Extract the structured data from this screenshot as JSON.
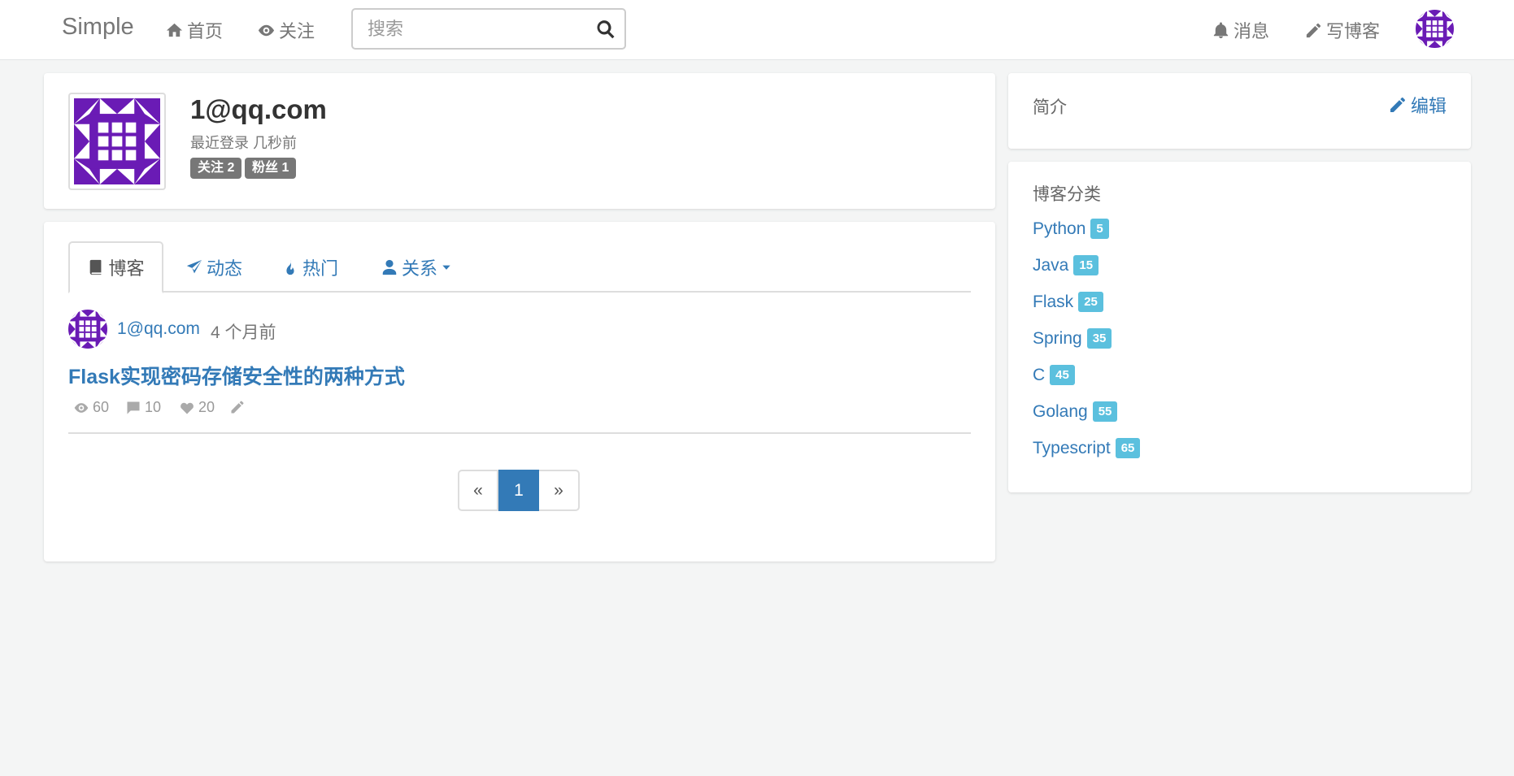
{
  "navbar": {
    "brand": "Simple",
    "home_label": "首页",
    "follow_label": "关注",
    "search_placeholder": "搜索",
    "messages_label": "消息",
    "write_label": "写博客"
  },
  "profile": {
    "name": "1@qq.com",
    "last_login": "最近登录 几秒前",
    "following_badge": "关注 2",
    "followers_badge": "粉丝 1"
  },
  "tabs": [
    {
      "label": "博客",
      "icon": "book-icon"
    },
    {
      "label": "动态",
      "icon": "paper-plane-icon"
    },
    {
      "label": "热门",
      "icon": "fire-icon"
    },
    {
      "label": "关系",
      "icon": "user-icon"
    }
  ],
  "post": {
    "author": "1@qq.com",
    "time": "4 个月前",
    "title": "Flask实现密码存储安全性的两种方式",
    "views": "60",
    "comments": "10",
    "likes": "20"
  },
  "pagination": {
    "prev": "«",
    "current": "1",
    "next": "»"
  },
  "intro": {
    "heading": "简介",
    "edit_label": "编辑"
  },
  "categories": {
    "heading": "博客分类",
    "items": [
      {
        "name": "Python",
        "count": "5"
      },
      {
        "name": "Java",
        "count": "15"
      },
      {
        "name": "Flask",
        "count": "25"
      },
      {
        "name": "Spring",
        "count": "35"
      },
      {
        "name": "C",
        "count": "45"
      },
      {
        "name": "Golang",
        "count": "55"
      },
      {
        "name": "Typescript",
        "count": "65"
      }
    ]
  },
  "colors": {
    "link": "#337ab7",
    "badge_info": "#5bc0de",
    "badge_dark": "#777777",
    "avatar_purple": "#6a1bb5"
  }
}
